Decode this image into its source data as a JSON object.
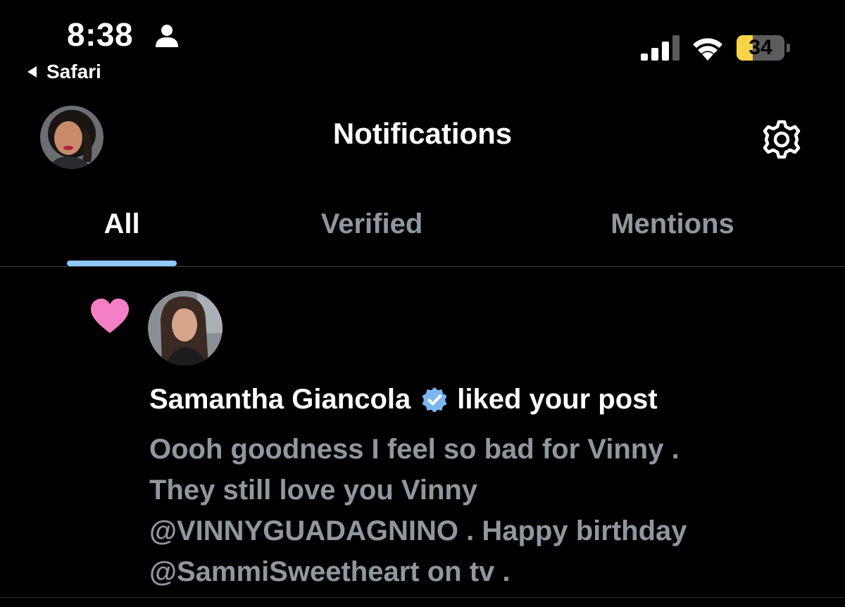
{
  "status_bar": {
    "time": "8:38",
    "back_app": "Safari",
    "battery_percent": 34,
    "battery_text": "34",
    "icons": [
      "person-icon",
      "signal-icon",
      "wifi-icon",
      "battery-icon"
    ]
  },
  "header": {
    "title": "Notifications",
    "avatar_icon": "profile-avatar",
    "settings_icon": "gear-icon"
  },
  "tabs": [
    {
      "label": "All",
      "active": true
    },
    {
      "label": "Verified",
      "active": false
    },
    {
      "label": "Mentions",
      "active": false
    }
  ],
  "notification": {
    "type_icon": "heart-icon",
    "user_name": "Samantha Giancola",
    "verified_icon": "verified-badge-icon",
    "action": "liked your post",
    "post_text": "Oooh goodness I feel so bad for Vinny .\nThey still love you Vinny\n@VINNYGUADAGNINO . Happy birthday\n@SammiSweetheart on tv ."
  },
  "colors": {
    "background": "#000000",
    "primary_text": "#ffffff",
    "secondary_text": "#8f979f",
    "tab_indicator": "#8ec8ff",
    "like_heart": "#f57fc4",
    "verified_blue": "#7ab7f0",
    "battery_fill": "#f5d547"
  }
}
